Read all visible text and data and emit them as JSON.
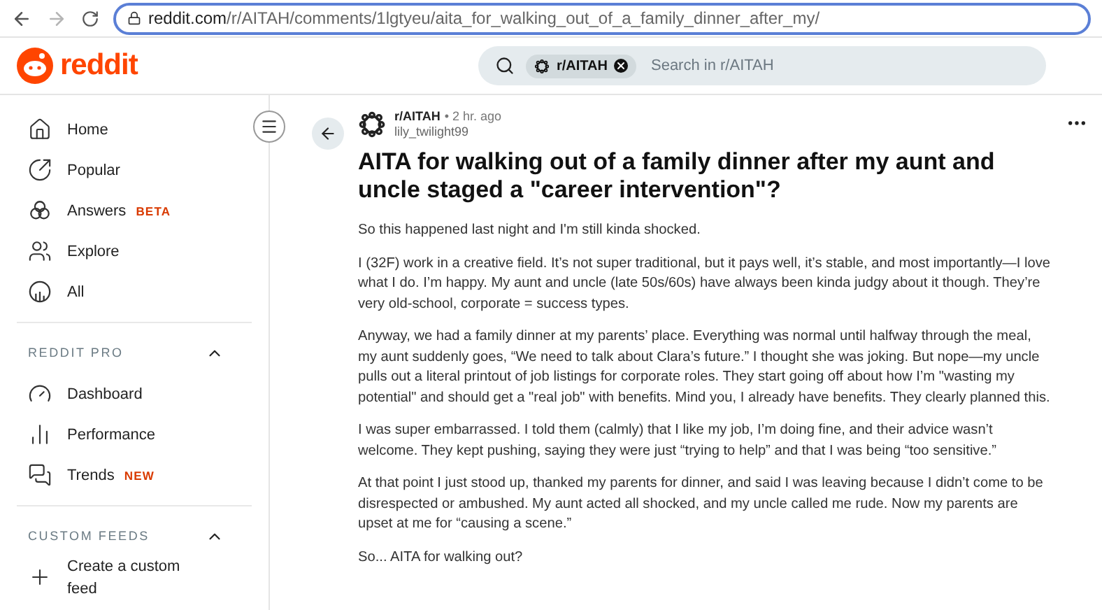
{
  "browser": {
    "url_host": "reddit.com",
    "url_path": "/r/AITAH/comments/1lgtyeu/aita_for_walking_out_of_a_family_dinner_after_my/"
  },
  "header": {
    "logo": "reddit",
    "search": {
      "chip": "r/AITAH",
      "placeholder": "Search in r/AITAH"
    }
  },
  "sidebar": {
    "items": [
      {
        "label": "Home"
      },
      {
        "label": "Popular"
      },
      {
        "label": "Answers",
        "badge": "BETA"
      },
      {
        "label": "Explore"
      },
      {
        "label": "All"
      }
    ],
    "sections": [
      {
        "title": "REDDIT PRO",
        "expanded": true,
        "items": [
          {
            "label": "Dashboard"
          },
          {
            "label": "Performance"
          },
          {
            "label": "Trends",
            "badge": "NEW"
          }
        ]
      },
      {
        "title": "CUSTOM FEEDS",
        "expanded": true,
        "items": [
          {
            "label": "Create a custom feed"
          }
        ]
      }
    ]
  },
  "post": {
    "subreddit": "r/AITAH",
    "time": "• 2 hr. ago",
    "author": "lily_twilight99",
    "title": "AITA for walking out of a family dinner after my aunt and uncle staged a \"career intervention\"?",
    "paragraphs": [
      "So this happened last night and I'm still kinda shocked.",
      "I (32F) work in a creative field. It’s not super traditional, but it pays well, it’s stable, and most importantly—I love what I do. I’m happy. My aunt and uncle (late 50s/60s) have always been kinda judgy about it though. They’re very old-school, corporate = success types.",
      "Anyway, we had a family dinner at my parents’ place. Everything was normal until halfway through the meal, my aunt suddenly goes, “We need to talk about Clara’s future.” I thought she was joking. But nope—my uncle pulls out a literal printout of job listings for corporate roles. They start going off about how I’m \"wasting my potential\" and should get a \"real job\" with benefits. Mind you, I already have benefits. They clearly planned this.",
      "I was super embarrassed. I told them (calmly) that I like my job, I’m doing fine, and their advice wasn’t welcome. They kept pushing, saying they were just “trying to help” and that I was being “too sensitive.”",
      "At that point I just stood up, thanked my parents for dinner, and said I was leaving because I didn’t come to be disrespected or ambushed. My aunt acted all shocked, and my uncle called me rude. Now my parents are upset at me for “causing a scene.”",
      "So... AITA for walking out?"
    ]
  }
}
